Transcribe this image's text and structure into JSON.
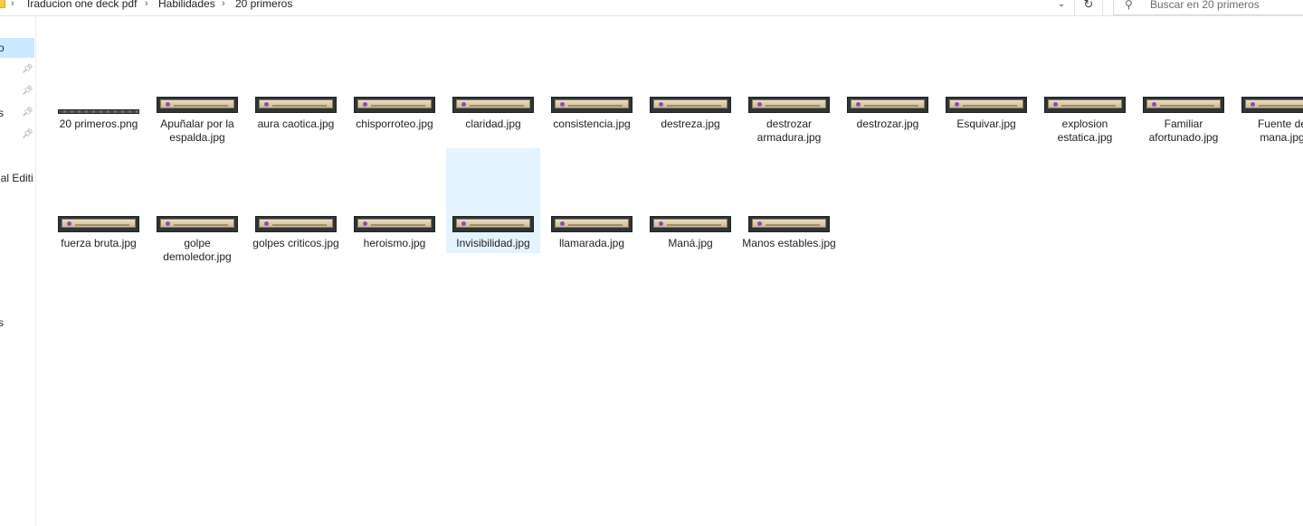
{
  "address_bar": {
    "breadcrumbs": [
      "Iraducion one deck pdf",
      "Habilidades",
      "20 primeros"
    ],
    "dropdown_glyph": "⌄",
    "refresh_glyph": "↻"
  },
  "search": {
    "placeholder": "Buscar en 20 primeros",
    "icon": "search-icon"
  },
  "nav_pane": {
    "items": [
      "o",
      "",
      "",
      "s",
      "",
      "ial Editi",
      "s"
    ]
  },
  "files": [
    {
      "name": "20 primeros.png"
    },
    {
      "name": "Apuñalar por la espalda.jpg"
    },
    {
      "name": "aura caotica.jpg"
    },
    {
      "name": "chisporroteo.jpg"
    },
    {
      "name": "claridad.jpg"
    },
    {
      "name": "consistencia.jpg"
    },
    {
      "name": "destreza.jpg"
    },
    {
      "name": "destrozar armadura.jpg"
    },
    {
      "name": "destrozar.jpg"
    },
    {
      "name": "Esquivar.jpg"
    },
    {
      "name": "explosion estatica.jpg"
    },
    {
      "name": "Familiar afortunado.jpg"
    },
    {
      "name": "Fuente de mana.jpg"
    },
    {
      "name": "fuerza bruta.jpg"
    },
    {
      "name": "golpe demoledor.jpg"
    },
    {
      "name": "golpes criticos.jpg"
    },
    {
      "name": "heroismo.jpg"
    },
    {
      "name": "Invisibilidad.jpg",
      "selected": true
    },
    {
      "name": "llamarada.jpg"
    },
    {
      "name": "Maná.jpg"
    },
    {
      "name": "Manos estables.jpg"
    }
  ],
  "colors": {
    "selection": "#cce8ff",
    "hover_selection": "#e5f3ff"
  }
}
